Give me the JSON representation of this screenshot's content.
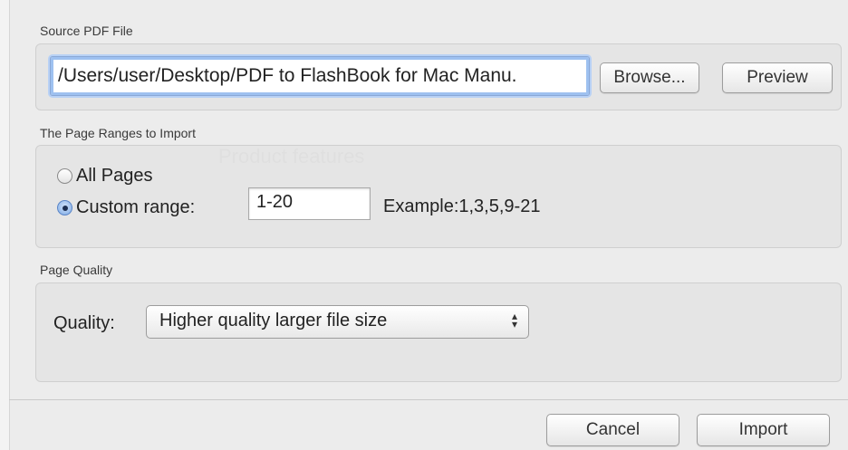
{
  "source": {
    "section_label": "Source PDF File",
    "path_value": "/Users/user/Desktop/PDF to FlashBook  for Mac Manu.",
    "browse_label": "Browse...",
    "preview_label": "Preview"
  },
  "page_ranges": {
    "section_label": "The Page Ranges to Import",
    "all_pages_label": "All Pages",
    "custom_range_label": "Custom range:",
    "custom_range_value": "1-20",
    "example_text": "Example:1,3,5,9-21",
    "selected": "custom"
  },
  "quality": {
    "section_label": "Page Quality",
    "field_label": "Quality:",
    "selected_option": "Higher quality larger file size"
  },
  "footer": {
    "cancel_label": "Cancel",
    "import_label": "Import"
  },
  "colors": {
    "focus_ring": "#9ec1f0",
    "radio_selected": "#7eaae4",
    "dialog_bg": "#ececec"
  }
}
